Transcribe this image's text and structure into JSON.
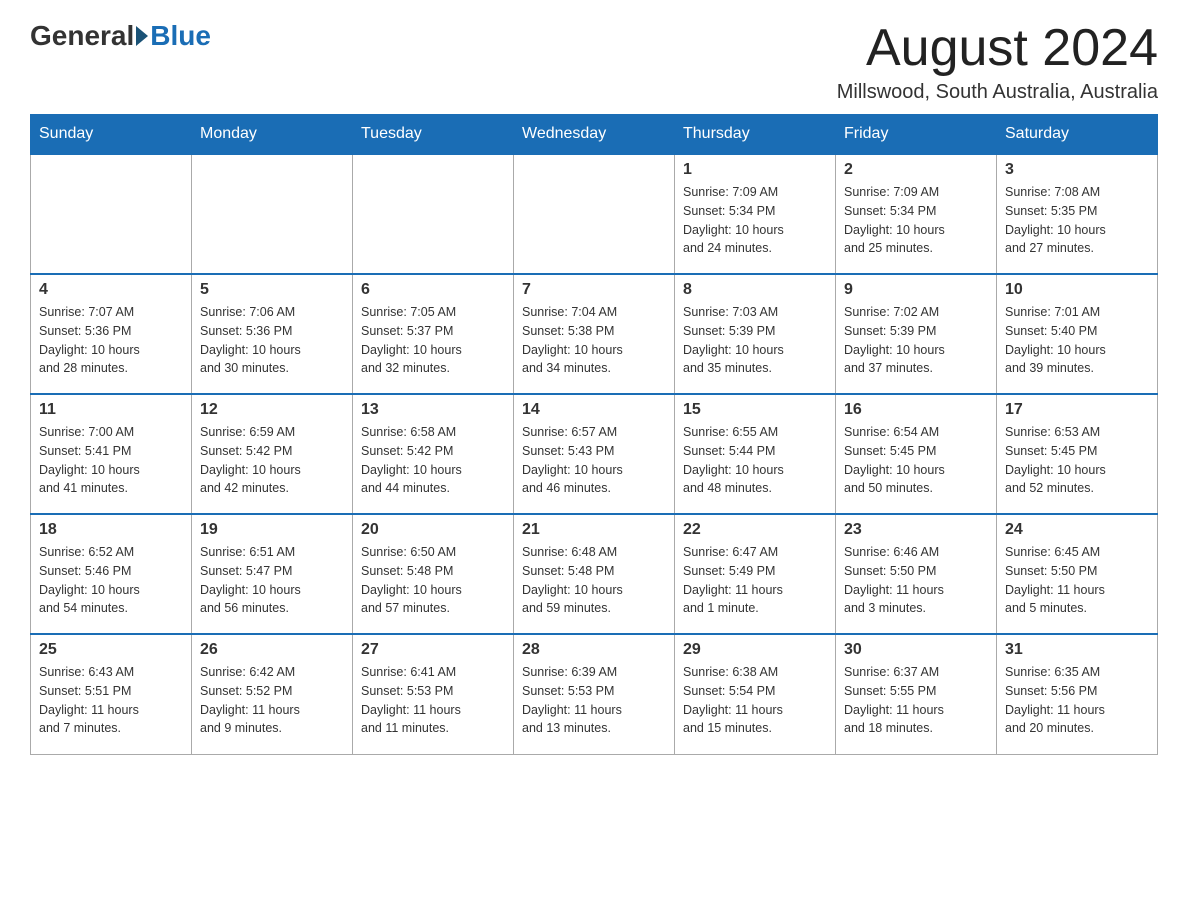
{
  "header": {
    "logo_general": "General",
    "logo_blue": "Blue",
    "month_title": "August 2024",
    "subtitle": "Millswood, South Australia, Australia"
  },
  "days_of_week": [
    "Sunday",
    "Monday",
    "Tuesday",
    "Wednesday",
    "Thursday",
    "Friday",
    "Saturday"
  ],
  "weeks": [
    [
      {
        "day": "",
        "info": ""
      },
      {
        "day": "",
        "info": ""
      },
      {
        "day": "",
        "info": ""
      },
      {
        "day": "",
        "info": ""
      },
      {
        "day": "1",
        "info": "Sunrise: 7:09 AM\nSunset: 5:34 PM\nDaylight: 10 hours\nand 24 minutes."
      },
      {
        "day": "2",
        "info": "Sunrise: 7:09 AM\nSunset: 5:34 PM\nDaylight: 10 hours\nand 25 minutes."
      },
      {
        "day": "3",
        "info": "Sunrise: 7:08 AM\nSunset: 5:35 PM\nDaylight: 10 hours\nand 27 minutes."
      }
    ],
    [
      {
        "day": "4",
        "info": "Sunrise: 7:07 AM\nSunset: 5:36 PM\nDaylight: 10 hours\nand 28 minutes."
      },
      {
        "day": "5",
        "info": "Sunrise: 7:06 AM\nSunset: 5:36 PM\nDaylight: 10 hours\nand 30 minutes."
      },
      {
        "day": "6",
        "info": "Sunrise: 7:05 AM\nSunset: 5:37 PM\nDaylight: 10 hours\nand 32 minutes."
      },
      {
        "day": "7",
        "info": "Sunrise: 7:04 AM\nSunset: 5:38 PM\nDaylight: 10 hours\nand 34 minutes."
      },
      {
        "day": "8",
        "info": "Sunrise: 7:03 AM\nSunset: 5:39 PM\nDaylight: 10 hours\nand 35 minutes."
      },
      {
        "day": "9",
        "info": "Sunrise: 7:02 AM\nSunset: 5:39 PM\nDaylight: 10 hours\nand 37 minutes."
      },
      {
        "day": "10",
        "info": "Sunrise: 7:01 AM\nSunset: 5:40 PM\nDaylight: 10 hours\nand 39 minutes."
      }
    ],
    [
      {
        "day": "11",
        "info": "Sunrise: 7:00 AM\nSunset: 5:41 PM\nDaylight: 10 hours\nand 41 minutes."
      },
      {
        "day": "12",
        "info": "Sunrise: 6:59 AM\nSunset: 5:42 PM\nDaylight: 10 hours\nand 42 minutes."
      },
      {
        "day": "13",
        "info": "Sunrise: 6:58 AM\nSunset: 5:42 PM\nDaylight: 10 hours\nand 44 minutes."
      },
      {
        "day": "14",
        "info": "Sunrise: 6:57 AM\nSunset: 5:43 PM\nDaylight: 10 hours\nand 46 minutes."
      },
      {
        "day": "15",
        "info": "Sunrise: 6:55 AM\nSunset: 5:44 PM\nDaylight: 10 hours\nand 48 minutes."
      },
      {
        "day": "16",
        "info": "Sunrise: 6:54 AM\nSunset: 5:45 PM\nDaylight: 10 hours\nand 50 minutes."
      },
      {
        "day": "17",
        "info": "Sunrise: 6:53 AM\nSunset: 5:45 PM\nDaylight: 10 hours\nand 52 minutes."
      }
    ],
    [
      {
        "day": "18",
        "info": "Sunrise: 6:52 AM\nSunset: 5:46 PM\nDaylight: 10 hours\nand 54 minutes."
      },
      {
        "day": "19",
        "info": "Sunrise: 6:51 AM\nSunset: 5:47 PM\nDaylight: 10 hours\nand 56 minutes."
      },
      {
        "day": "20",
        "info": "Sunrise: 6:50 AM\nSunset: 5:48 PM\nDaylight: 10 hours\nand 57 minutes."
      },
      {
        "day": "21",
        "info": "Sunrise: 6:48 AM\nSunset: 5:48 PM\nDaylight: 10 hours\nand 59 minutes."
      },
      {
        "day": "22",
        "info": "Sunrise: 6:47 AM\nSunset: 5:49 PM\nDaylight: 11 hours\nand 1 minute."
      },
      {
        "day": "23",
        "info": "Sunrise: 6:46 AM\nSunset: 5:50 PM\nDaylight: 11 hours\nand 3 minutes."
      },
      {
        "day": "24",
        "info": "Sunrise: 6:45 AM\nSunset: 5:50 PM\nDaylight: 11 hours\nand 5 minutes."
      }
    ],
    [
      {
        "day": "25",
        "info": "Sunrise: 6:43 AM\nSunset: 5:51 PM\nDaylight: 11 hours\nand 7 minutes."
      },
      {
        "day": "26",
        "info": "Sunrise: 6:42 AM\nSunset: 5:52 PM\nDaylight: 11 hours\nand 9 minutes."
      },
      {
        "day": "27",
        "info": "Sunrise: 6:41 AM\nSunset: 5:53 PM\nDaylight: 11 hours\nand 11 minutes."
      },
      {
        "day": "28",
        "info": "Sunrise: 6:39 AM\nSunset: 5:53 PM\nDaylight: 11 hours\nand 13 minutes."
      },
      {
        "day": "29",
        "info": "Sunrise: 6:38 AM\nSunset: 5:54 PM\nDaylight: 11 hours\nand 15 minutes."
      },
      {
        "day": "30",
        "info": "Sunrise: 6:37 AM\nSunset: 5:55 PM\nDaylight: 11 hours\nand 18 minutes."
      },
      {
        "day": "31",
        "info": "Sunrise: 6:35 AM\nSunset: 5:56 PM\nDaylight: 11 hours\nand 20 minutes."
      }
    ]
  ]
}
